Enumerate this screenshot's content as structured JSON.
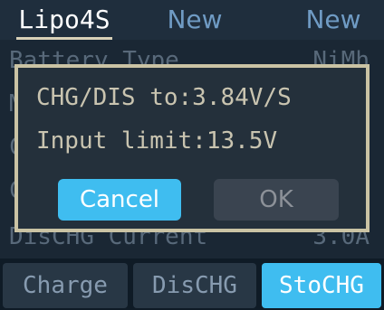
{
  "top_tabs": [
    {
      "label": "Lipo4S",
      "active": true
    },
    {
      "label": "New",
      "active": false
    },
    {
      "label": "New",
      "active": false
    }
  ],
  "list_rows": [
    {
      "label": "Battery Type",
      "value": "NiMh"
    },
    {
      "label": "M",
      "value": ""
    },
    {
      "label": "C",
      "value": ""
    },
    {
      "label": "C",
      "value": ""
    },
    {
      "label": "DisCHG Current",
      "value": "3.0A"
    }
  ],
  "dialog": {
    "line1": "CHG/DIS to:3.84V/S",
    "line2": "Input limit:13.5V",
    "cancel_label": "Cancel",
    "ok_label": "OK"
  },
  "bottom_buttons": [
    {
      "label": "Charge",
      "active": false
    },
    {
      "label": "DisCHG",
      "active": false
    },
    {
      "label": "StoCHG",
      "active": true
    }
  ],
  "colors": {
    "accent": "#3fbdf0",
    "dialog_border": "#cac3a4",
    "inactive_tab_text": "#6f9bc4"
  }
}
